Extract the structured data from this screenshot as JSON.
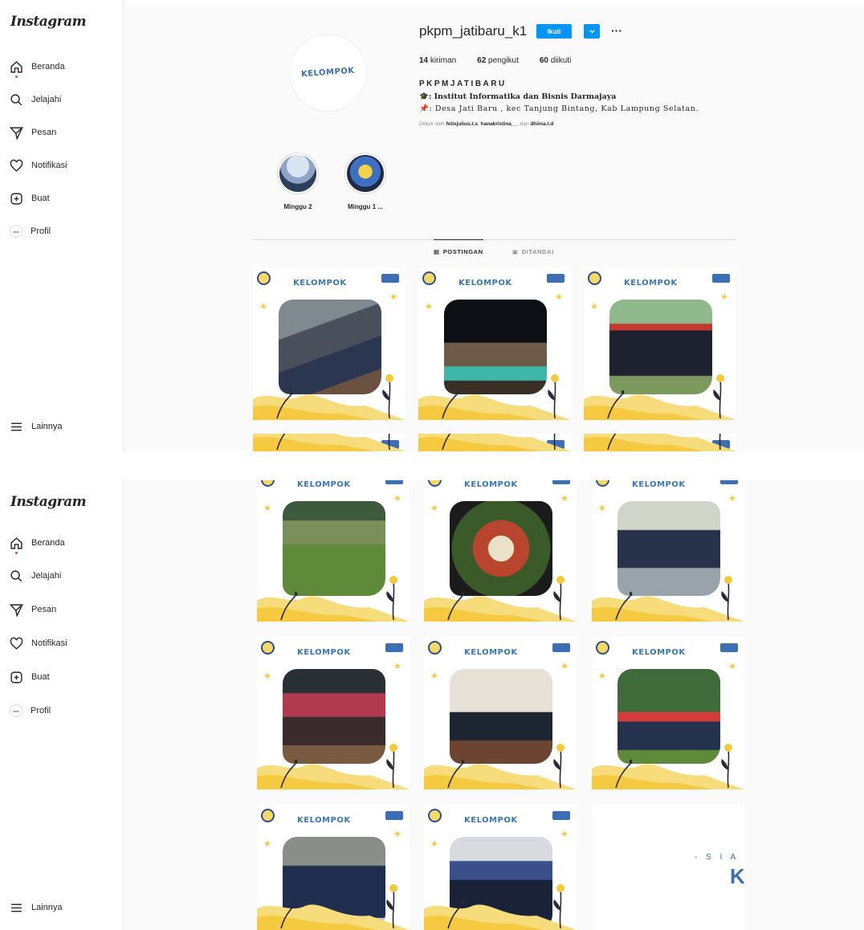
{
  "app": {
    "logo": "Instagram"
  },
  "sidebar": {
    "items": [
      {
        "label": "Beranda",
        "icon": "home-icon"
      },
      {
        "label": "Jelajahi",
        "icon": "search-icon"
      },
      {
        "label": "Pesan",
        "icon": "send-icon"
      },
      {
        "label": "Notifikasi",
        "icon": "heart-icon"
      },
      {
        "label": "Buat",
        "icon": "plus-square-icon"
      },
      {
        "label": "Profil",
        "icon": "profile-avatar-icon"
      }
    ],
    "more_label": "Lainnya"
  },
  "profile": {
    "username": "pkpm_jatibaru_k1",
    "follow_label": "Ikuti",
    "posts": "14",
    "posts_label": "kiriman",
    "followers": "62",
    "followers_label": "pengikut",
    "following": "60",
    "following_label": "diikuti",
    "full_name": "PKPMJATIBARU",
    "bio_line1": ": Institut Informatika dan Bisnis Darmajaya",
    "bio_line2": ": Desa Jati Baru , kec Tanjung Bintang, Kab Lampung Selatan.",
    "followed_by_prefix": "Diikuti oleh",
    "followed_by_1": "felixjulius.t.s",
    "followed_by_2": "hanakristina__",
    "followed_by_mid": "dan",
    "followed_by_3": "dhiina.t.d",
    "avatar_text": "KELOMPOK"
  },
  "highlights": [
    {
      "label": "Minggu 2"
    },
    {
      "label": "Minggu 1 ..."
    }
  ],
  "tabs": [
    {
      "label": "POSTINGAN",
      "active": true
    },
    {
      "label": "DITANDAI",
      "active": false
    }
  ],
  "post_title": "KELOMPOK",
  "partial_tile_text": "- S I A",
  "colors": {
    "accent": "#0095f6",
    "frame_blue": "#3b76b5",
    "floral_yellow": "#f5c940"
  }
}
